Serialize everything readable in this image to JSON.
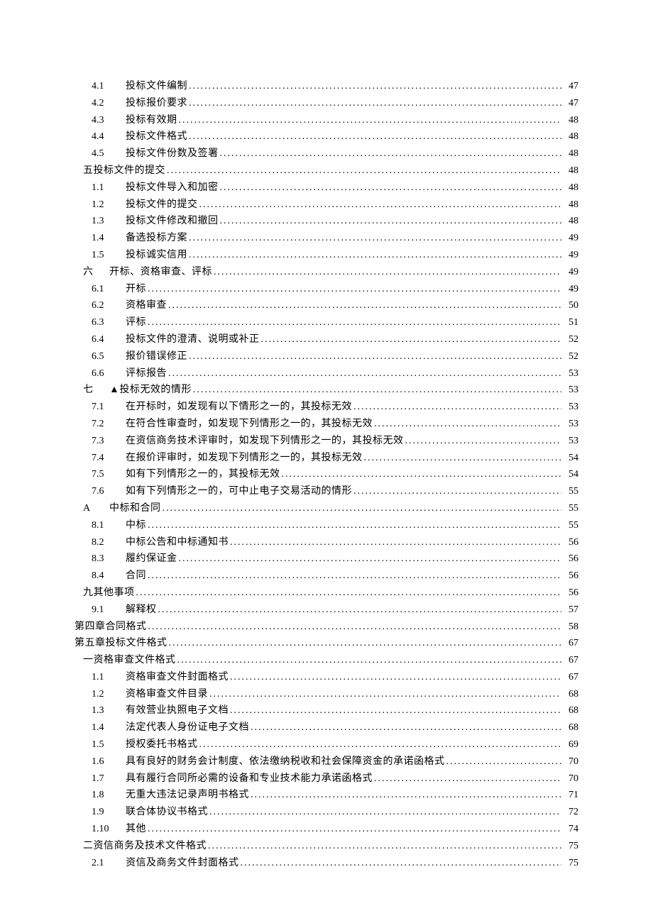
{
  "toc": [
    {
      "level": 2,
      "num": "4.1",
      "label": "投标文件编制",
      "page": "47"
    },
    {
      "level": 2,
      "num": "4.2",
      "label": "投标报价要求",
      "page": "47"
    },
    {
      "level": 2,
      "num": "4.3",
      "label": "投标有效期",
      "page": "48"
    },
    {
      "level": 2,
      "num": "4.4",
      "label": "投标文件格式",
      "page": "48"
    },
    {
      "level": 2,
      "num": "4.5",
      "label": "投标文件份数及签署",
      "page": "48"
    },
    {
      "level": 1,
      "num": "",
      "label": "五投标文件的提交",
      "page": "48"
    },
    {
      "level": 2,
      "num": "1.1",
      "label": "投标文件导入和加密",
      "page": "48"
    },
    {
      "level": 2,
      "num": "1.2",
      "label": "投标文件的提交",
      "page": "48"
    },
    {
      "level": 2,
      "num": "1.3",
      "label": "投标文件修改和撤回",
      "page": "48"
    },
    {
      "level": 2,
      "num": "1.4",
      "label": "备选投标方案",
      "page": "49"
    },
    {
      "level": 2,
      "num": "1.5",
      "label": "投标诚实信用",
      "page": "49"
    },
    {
      "level": 1,
      "num": "六",
      "label": "开标、资格审查、评标",
      "page": "49"
    },
    {
      "level": 2,
      "num": "6.1",
      "label": "开标",
      "page": "49"
    },
    {
      "level": 2,
      "num": "6.2",
      "label": "资格审查",
      "page": "50"
    },
    {
      "level": 2,
      "num": "6.3",
      "label": "评标",
      "page": "51"
    },
    {
      "level": 2,
      "num": "6.4",
      "label": "投标文件的澄清、说明或补正",
      "page": "52"
    },
    {
      "level": 2,
      "num": "6.5",
      "label": "报价错误修正",
      "page": "52"
    },
    {
      "level": 2,
      "num": "6.6",
      "label": "评标报告",
      "page": "53"
    },
    {
      "level": 1,
      "num": "七",
      "label": "▲投标无效的情形",
      "page": "53"
    },
    {
      "level": 2,
      "num": "7.1",
      "label": "在开标时，如发现有以下情形之一的，其投标无效",
      "page": "53"
    },
    {
      "level": 2,
      "num": "7.2",
      "label": "在符合性审查时，如发现下列情形之一的，其投标无效",
      "page": "53"
    },
    {
      "level": 2,
      "num": "7.3",
      "label": "在资信商务技术评审时，如发现下列情形之一的，其投标无效",
      "page": "53"
    },
    {
      "level": 2,
      "num": "7.4",
      "label": "在报价评审时，如发现下列情形之一的，其投标无效",
      "page": "54"
    },
    {
      "level": 2,
      "num": "7.5",
      "label": "如有下列情形之一的，其投标无效",
      "page": "54"
    },
    {
      "level": 2,
      "num": "7.6",
      "label": "如有下列情形之一的，可中止电子交易活动的情形",
      "page": "55"
    },
    {
      "level": 1,
      "num": "A",
      "label": "中标和合同",
      "page": "55"
    },
    {
      "level": 2,
      "num": "8.1",
      "label": "中标",
      "page": "55"
    },
    {
      "level": 2,
      "num": "8.2",
      "label": "中标公告和中标通知书",
      "page": "56"
    },
    {
      "level": 2,
      "num": "8.3",
      "label": "履约保证金",
      "page": "56"
    },
    {
      "level": 2,
      "num": "8.4",
      "label": "合同",
      "page": "56"
    },
    {
      "level": 1,
      "num": "",
      "label": "九其他事项",
      "page": "56"
    },
    {
      "level": 2,
      "num": "9.1",
      "label": "解释权",
      "page": "57"
    },
    {
      "level": 0,
      "num": "",
      "label": "第四章合同格式",
      "page": "58"
    },
    {
      "level": 0,
      "num": "",
      "label": "第五章投标文件格式",
      "page": "67"
    },
    {
      "level": 1,
      "num": "",
      "label": "一资格审查文件格式",
      "page": "67"
    },
    {
      "level": 2,
      "num": "1.1",
      "label": "资格审查文件封面格式",
      "page": "67"
    },
    {
      "level": 2,
      "num": "1.2",
      "label": "资格审查文件目录",
      "page": "68"
    },
    {
      "level": 2,
      "num": "1.3",
      "label": "有效营业执照电子文档",
      "page": "68"
    },
    {
      "level": 2,
      "num": "1.4",
      "label": "法定代表人身份证电子文档",
      "page": "68"
    },
    {
      "level": 2,
      "num": "1.5",
      "label": "授权委托书格式",
      "page": "69"
    },
    {
      "level": 2,
      "num": "1.6",
      "label": "具有良好的财务会计制度、依法缴纳税收和社会保障资金的承诺函格式",
      "page": "70"
    },
    {
      "level": 2,
      "num": "1.7",
      "label": "具有履行合同所必需的设备和专业技术能力承诺函格式",
      "page": "70"
    },
    {
      "level": 2,
      "num": "1.8",
      "label": "无重大违法记录声明书格式",
      "page": "71"
    },
    {
      "level": 2,
      "num": "1.9",
      "label": "联合体协议书格式",
      "page": "72"
    },
    {
      "level": 2,
      "num": "1.10",
      "label": "其他",
      "page": "74"
    },
    {
      "level": 1,
      "num": "",
      "label": "二资信商务及技术文件格式",
      "page": "75"
    },
    {
      "level": 2,
      "num": "2.1",
      "label": "资信及商务文件封面格式",
      "page": "75"
    }
  ]
}
